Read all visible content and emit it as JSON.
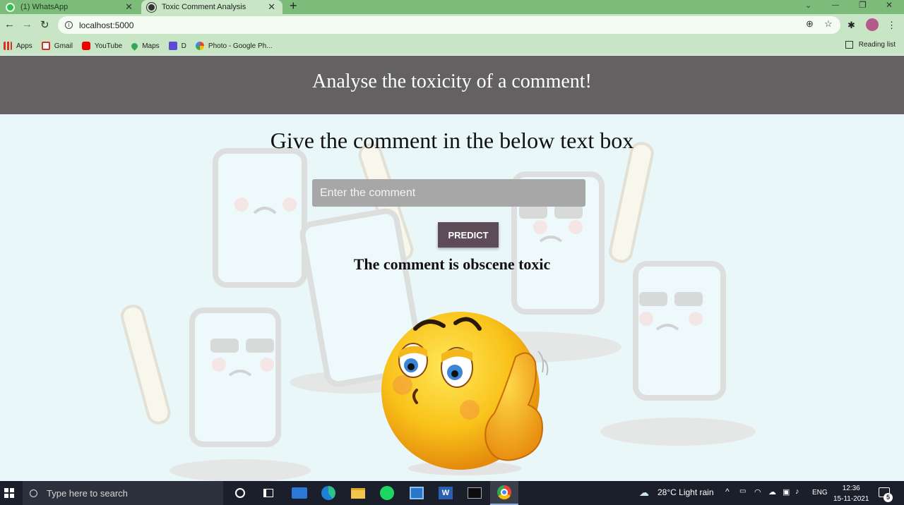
{
  "browser": {
    "tabs": [
      {
        "label": "(1) WhatsApp",
        "close": "✕"
      },
      {
        "label": "Toxic Comment Analysis",
        "close": "✕"
      }
    ],
    "new_tab": "+",
    "window_controls": {
      "minimize": "—",
      "restore": "❐",
      "close": "✕",
      "menu": "⌄"
    },
    "url": "localhost:5000",
    "bookmarks": [
      {
        "label": "Apps",
        "icon": "apps-grid-icon",
        "color": "#d93025"
      },
      {
        "label": "Gmail",
        "icon": "gmail-icon",
        "color": "#d93025"
      },
      {
        "label": "YouTube",
        "icon": "youtube-icon",
        "color": "#e00"
      },
      {
        "label": "Maps",
        "icon": "maps-icon",
        "color": "#34a853"
      },
      {
        "label": "D",
        "icon": "bookmark-list-icon",
        "color": "#5b4bd6"
      },
      {
        "label": "Photo - Google Ph...",
        "icon": "google-photos-icon",
        "color": "#fbbc04"
      }
    ],
    "reading_list": "Reading list"
  },
  "page": {
    "header_title": "Analyse the toxicity of a comment!",
    "subtitle": "Give the comment in the below text box",
    "input_placeholder": "Enter the comment",
    "predict_label": "PREDICT",
    "result_text": "The comment is obscene toxic",
    "colors": {
      "header_bg": "#636162",
      "page_bg": "#eaf7f8",
      "button_bg": "#5d4c58",
      "input_bg": "#a7a7a8"
    }
  },
  "taskbar": {
    "search_placeholder": "Type here to search",
    "weather": "28°C  Light rain",
    "language": "ENG",
    "time": "12:36",
    "date": "15-11-2021",
    "notifications": "5",
    "apps": [
      "cortana-icon",
      "task-view-icon",
      "mail-icon",
      "edge-icon",
      "file-explorer-icon",
      "spotify-icon",
      "photos-icon",
      "word-icon",
      "terminal-icon",
      "chrome-icon"
    ]
  }
}
